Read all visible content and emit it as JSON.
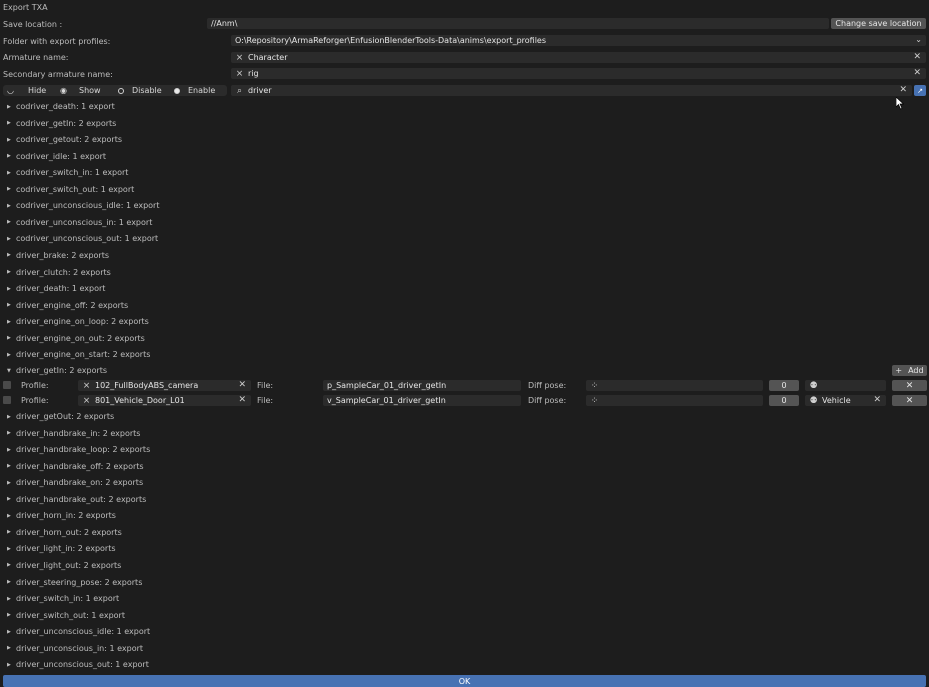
{
  "window_title": "Export TXA",
  "save_location": {
    "label": "Save location :",
    "value": "//Anm\\",
    "button": "Change save location"
  },
  "profiles_folder": {
    "label": "Folder with export profiles:",
    "value": "O:\\Repository\\ArmaReforger\\EnfusionBlenderTools-Data\\anims\\export_profiles"
  },
  "armature": {
    "label": "Armature name:",
    "value": "Character"
  },
  "secondary_armature": {
    "label": "Secondary armature name:",
    "value": "rig"
  },
  "toggles": {
    "hide": "Hide",
    "show": "Show",
    "disable": "Disable",
    "enable": "Enable"
  },
  "search": {
    "value": "driver"
  },
  "groups_top": [
    "codriver_death: 1 export",
    "codriver_getIn: 2 exports",
    "codriver_getout: 2 exports",
    "codriver_idle: 1 export",
    "codriver_switch_in: 1 export",
    "codriver_switch_out: 1 export",
    "codriver_unconscious_idle: 1 export",
    "codriver_unconscious_in: 1 export",
    "codriver_unconscious_out: 1 export",
    "driver_brake: 2 exports",
    "driver_clutch: 2 exports",
    "driver_death: 1 export",
    "driver_engine_off: 2 exports",
    "driver_engine_on_loop: 2 exports",
    "driver_engine_on_out: 2 exports",
    "driver_engine_on_start: 2 exports"
  ],
  "expanded_group": {
    "label": "driver_getIn: 2 exports",
    "add_label": "Add",
    "rows": [
      {
        "profile_label": "Profile:",
        "profile": "102_FullBodyABS_camera",
        "file_label": "File:",
        "file": "p_SampleCar_01_driver_getIn",
        "diff_label": "Diff pose:",
        "num": "0",
        "bone": ""
      },
      {
        "profile_label": "Profile:",
        "profile": "801_Vehicle_Door_L01",
        "file_label": "File:",
        "file": "v_SampleCar_01_driver_getIn",
        "diff_label": "Diff pose:",
        "num": "0",
        "bone": "Vehicle"
      }
    ]
  },
  "groups_bottom": [
    "driver_getOut: 2 exports",
    "driver_handbrake_in: 2 exports",
    "driver_handbrake_loop: 2 exports",
    "driver_handbrake_off: 2 exports",
    "driver_handbrake_on: 2 exports",
    "driver_handbrake_out: 2 exports",
    "driver_horn_in: 2 exports",
    "driver_horn_out: 2 exports",
    "driver_light_in: 2 exports",
    "driver_light_out: 2 exports",
    "driver_steering_pose: 2 exports",
    "driver_switch_in: 1 export",
    "driver_switch_out: 1 export",
    "driver_unconscious_idle: 1 export",
    "driver_unconscious_in: 1 export",
    "driver_unconscious_out: 1 export"
  ],
  "ok_label": "OK",
  "icons": {
    "armature": "armature-icon",
    "search": "search-icon",
    "close": "close-icon",
    "arrow": "disclosure-triangle-icon"
  },
  "colors": {
    "background": "#1d1d1d",
    "field": "#2b2b2b",
    "button": "#545454",
    "accent": "#4772b3"
  }
}
